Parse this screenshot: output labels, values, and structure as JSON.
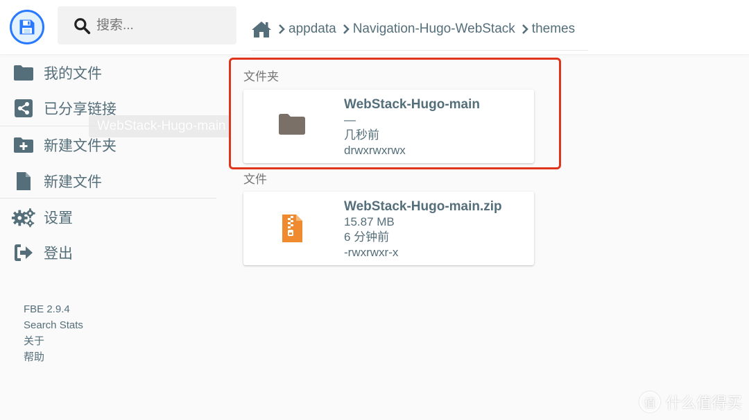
{
  "search": {
    "placeholder": "搜索..."
  },
  "breadcrumbs": [
    {
      "label": "appdata"
    },
    {
      "label": "Navigation-Hugo-WebStack"
    },
    {
      "label": "themes"
    }
  ],
  "sidebar": {
    "items": [
      {
        "label": "我的文件",
        "icon": "folder-icon"
      },
      {
        "label": "已分享链接",
        "icon": "share-icon"
      },
      {
        "label": "新建文件夹",
        "icon": "new-folder-icon"
      },
      {
        "label": "新建文件",
        "icon": "new-file-icon"
      },
      {
        "label": "设置",
        "icon": "settings-icon"
      },
      {
        "label": "登出",
        "icon": "logout-icon"
      }
    ],
    "drag_ghost": "WebStack-Hugo-main",
    "credits": [
      "FBE 2.9.4",
      "Search Stats",
      "关于",
      "帮助"
    ]
  },
  "listing": {
    "folders_label": "文件夹",
    "files_label": "文件",
    "folders": [
      {
        "name": "WebStack-Hugo-main",
        "size": "—",
        "modified": "几秒前",
        "permissions": "drwxrwxrwx"
      }
    ],
    "files": [
      {
        "name": "WebStack-Hugo-main.zip",
        "size": "15.87 MB",
        "modified": "6 分钟前",
        "permissions": "-rwxrwxr-x"
      }
    ]
  },
  "watermark": {
    "text": "什么值得买",
    "icon_glyph": "值"
  },
  "colors": {
    "accent": "#2979ff",
    "text": "#546e7a",
    "folder": "#7b7068",
    "zip": "#ef8a2e",
    "highlight": "#e0331c"
  }
}
